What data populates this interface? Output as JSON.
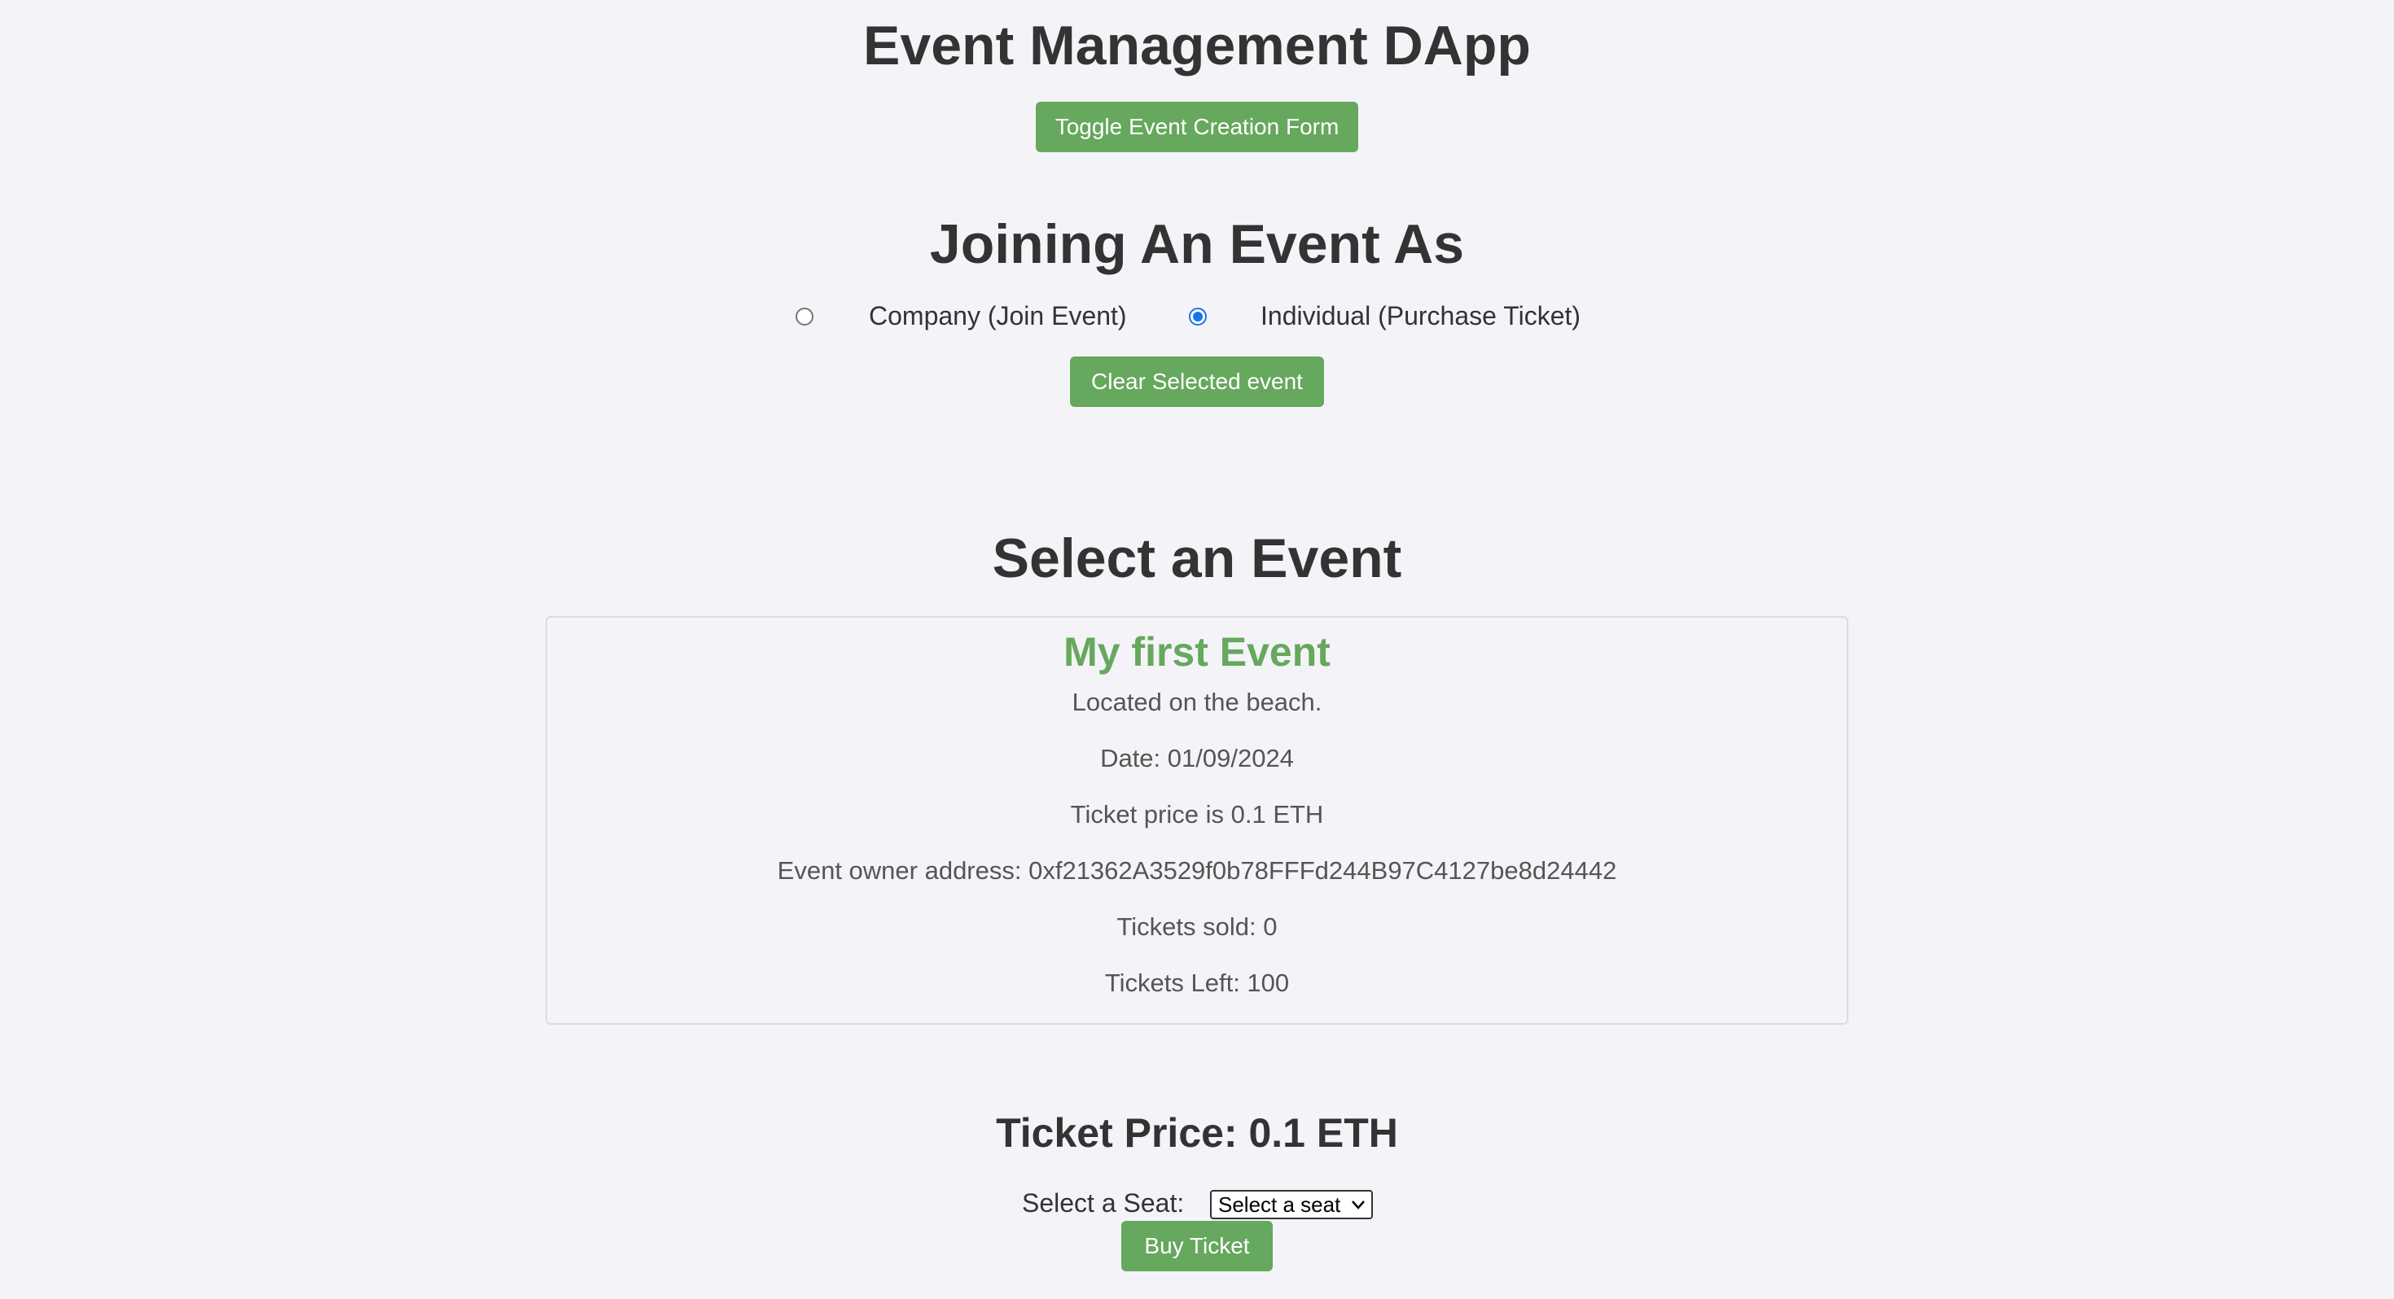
{
  "header": {
    "title": "Event Management DApp",
    "toggle_button": "Toggle Event Creation Form"
  },
  "join": {
    "heading": "Joining An Event As",
    "options": [
      {
        "label": "Company (Join Event)",
        "selected": false
      },
      {
        "label": "Individual (Purchase Ticket)",
        "selected": true
      }
    ],
    "clear_button": "Clear Selected event"
  },
  "events": {
    "heading": "Select an Event",
    "card": {
      "title": "My first Event",
      "description": "Located on the beach.",
      "date": "Date: 01/09/2024",
      "price": "Ticket price is 0.1 ETH",
      "owner": "Event owner address: 0xf21362A3529f0b78FFFd244B97C4127be8d24442",
      "sold": "Tickets sold: 0",
      "left": "Tickets Left: 100"
    }
  },
  "purchase": {
    "price_heading": "Ticket Price: 0.1 ETH",
    "seat_label": "Select a Seat:",
    "seat_select_value": "Select a seat",
    "buy_button": "Buy Ticket"
  },
  "colors": {
    "accent": "#66a85d",
    "background": "#f4f4f8",
    "radio_selected": "#1a73e8"
  }
}
